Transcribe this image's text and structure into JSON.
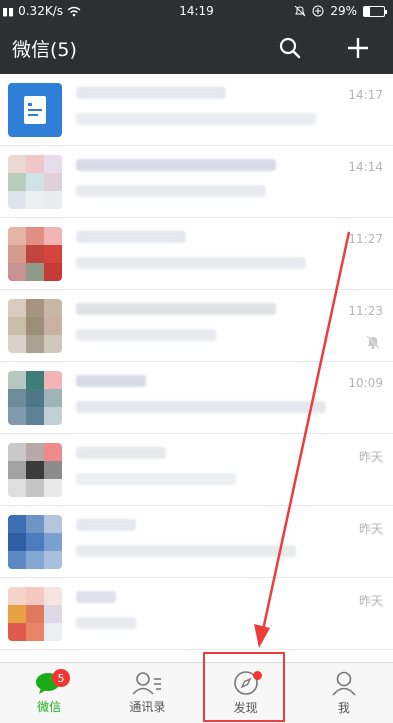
{
  "status_bar": {
    "network_speed": "0.32K/s",
    "time": "14:19",
    "battery": "29%",
    "battery_level": 0.29
  },
  "app_bar": {
    "title": "微信(5)",
    "search_icon": "search-icon",
    "add_icon": "plus-icon"
  },
  "chats": [
    {
      "time": "14:17",
      "muted": false
    },
    {
      "time": "14:14",
      "muted": false
    },
    {
      "time": "11:27",
      "muted": false
    },
    {
      "time": "11:23",
      "muted": true
    },
    {
      "time": "10:09",
      "muted": false
    },
    {
      "time": "昨天",
      "muted": false
    },
    {
      "time": "昨天",
      "muted": false
    },
    {
      "time": "昨天",
      "muted": false
    }
  ],
  "tabs": [
    {
      "label": "微信",
      "icon": "chat-bubble-icon",
      "active": true,
      "badge": "5"
    },
    {
      "label": "通讯录",
      "icon": "contacts-icon",
      "active": false
    },
    {
      "label": "发现",
      "icon": "compass-icon",
      "active": false,
      "dot": true
    },
    {
      "label": "我",
      "icon": "person-icon",
      "active": false
    }
  ],
  "colors": {
    "header_bg": "#2e2f33",
    "active_tab": "#1aad19",
    "badge": "#f43530",
    "annotation": "#ee3c3c"
  }
}
